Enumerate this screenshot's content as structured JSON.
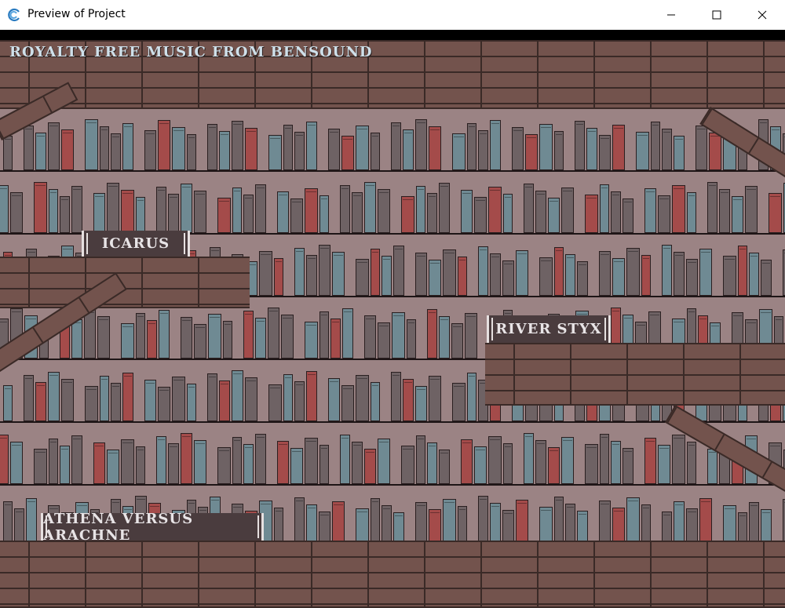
{
  "window": {
    "title": "Preview of Project",
    "icon": "swirl-app-icon",
    "controls": [
      "minimize-icon",
      "maximize-icon",
      "close-icon"
    ]
  },
  "game": {
    "credit": "Royalty Free Music from Bensound",
    "levels": [
      {
        "label": "Icarus"
      },
      {
        "label": "River Styx"
      },
      {
        "label": "Athena versus Arachne"
      }
    ]
  },
  "colors": {
    "wall": "#9b8384",
    "wood": "#73534d",
    "book_red": "#a44b4a",
    "book_blue": "#6f8a93",
    "book_grey": "#6e6264",
    "sign": "#4a3c3e"
  }
}
